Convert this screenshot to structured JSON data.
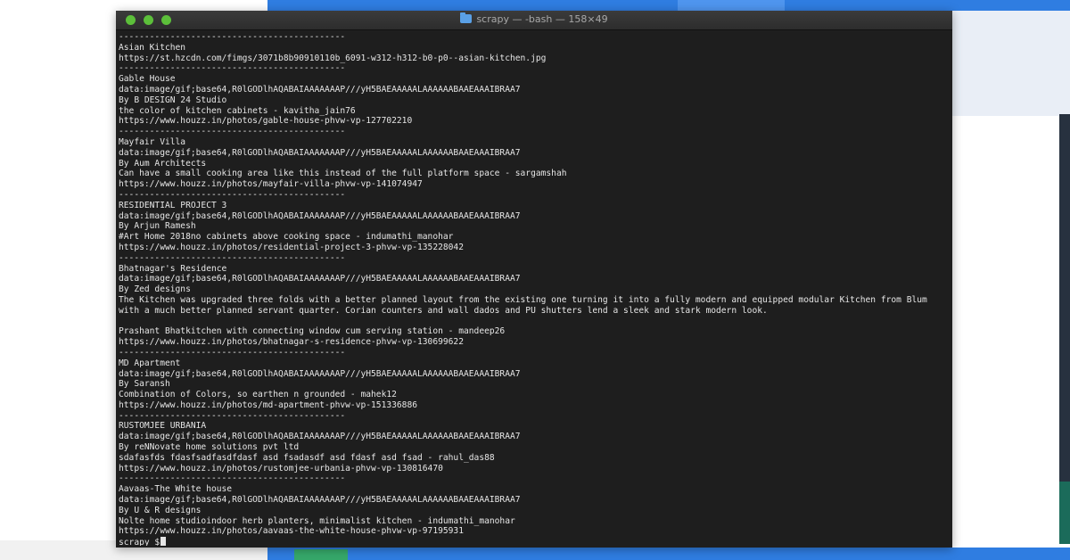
{
  "window": {
    "title": "scrapy — -bash — 158×49",
    "traffic_light_color": "#5cbf3a"
  },
  "terminal": {
    "lines": [
      "--------------------------------------------",
      "Asian Kitchen",
      "https://st.hzcdn.com/fimgs/3071b8b90910110b_6091-w312-h312-b0-p0--asian-kitchen.jpg",
      "--------------------------------------------",
      "Gable House",
      "data:image/gif;base64,R0lGODlhAQABAIAAAAAAAP///yH5BAEAAAAALAAAAAABAAEAAAIBRAA7",
      "By B DESIGN 24 Studio",
      "the color of kitchen cabinets - kavitha_jain76",
      "https://www.houzz.in/photos/gable-house-phvw-vp-127702210",
      "--------------------------------------------",
      "Mayfair Villa",
      "data:image/gif;base64,R0lGODlhAQABAIAAAAAAAP///yH5BAEAAAAALAAAAAABAAEAAAIBRAA7",
      "By Aum Architects",
      "Can have a small cooking area like this instead of the full platform space - sargamshah",
      "https://www.houzz.in/photos/mayfair-villa-phvw-vp-141074947",
      "--------------------------------------------",
      "RESIDENTIAL PROJECT 3",
      "data:image/gif;base64,R0lGODlhAQABAIAAAAAAAP///yH5BAEAAAAALAAAAAABAAEAAAIBRAA7",
      "By Arjun Ramesh",
      "#Art Home 2018no cabinets above cooking space - indumathi_manohar",
      "https://www.houzz.in/photos/residential-project-3-phvw-vp-135228042",
      "--------------------------------------------",
      "Bhatnagar's Residence",
      "data:image/gif;base64,R0lGODlhAQABAIAAAAAAAP///yH5BAEAAAAALAAAAAABAAEAAAIBRAA7",
      "By Zed designs",
      "The Kitchen was upgraded three folds with a better planned layout from the existing one turning it into a fully modern and equipped modular Kitchen from Blum",
      "with a much better planned servant quarter. Corian counters and wall dados and PU shutters lend a sleek and stark modern look.",
      "",
      "Prashant Bhatkitchen with connecting window cum serving station - mandeep26",
      "https://www.houzz.in/photos/bhatnagar-s-residence-phvw-vp-130699622",
      "--------------------------------------------",
      "MD Apartment",
      "data:image/gif;base64,R0lGODlhAQABAIAAAAAAAP///yH5BAEAAAAALAAAAAABAAEAAAIBRAA7",
      "By Saransh",
      "Combination of Colors, so earthen n grounded - mahek12",
      "https://www.houzz.in/photos/md-apartment-phvw-vp-151336886",
      "--------------------------------------------",
      "RUSTOMJEE URBANIA",
      "data:image/gif;base64,R0lGODlhAQABAIAAAAAAAP///yH5BAEAAAAALAAAAAABAAEAAAIBRAA7",
      "By reNNovate home solutions pvt ltd",
      "sdafasfds fdasfsadfasdfdasf asd fsadasdf asd fdasf asd fsad - rahul_das88",
      "https://www.houzz.in/photos/rustomjee-urbania-phvw-vp-130816470",
      "--------------------------------------------",
      "Aavaas-The White house",
      "data:image/gif;base64,R0lGODlhAQABAIAAAAAAAP///yH5BAEAAAAALAAAAAABAAEAAAIBRAA7",
      "By U & R designs",
      "Nolte home studioindoor herb planters, minimalist kitchen - indumathi_manohar",
      "https://www.houzz.in/photos/aavaas-the-white-house-phvw-vp-97195931"
    ],
    "prompt": "scrapy $"
  }
}
